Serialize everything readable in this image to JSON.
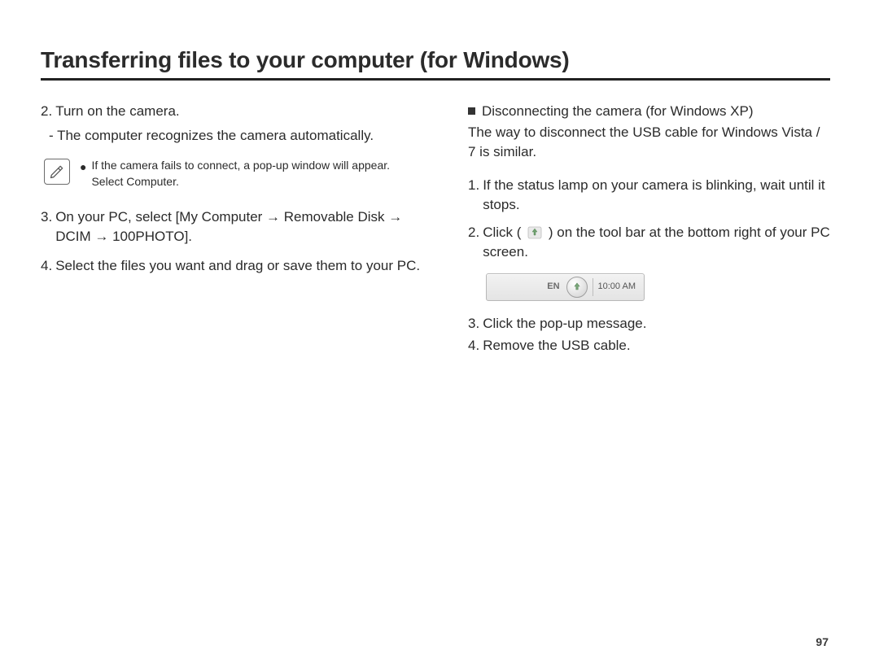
{
  "title": "Transferring files to your computer (for Windows)",
  "left": {
    "steps": [
      {
        "num": "2.",
        "text": "Turn on the camera."
      },
      {
        "num": "3.",
        "text": "On your PC, select [My Computer → Removable Disk → DCIM → 100PHOTO]."
      },
      {
        "num": "4.",
        "text": "Select the files you want and drag or save them to your PC."
      }
    ],
    "substep_after_2": "The computer recognizes the camera automatically.",
    "note": {
      "line1": "If the camera fails to connect, a pop-up window will appear.",
      "line2": "Select Computer."
    }
  },
  "right": {
    "heading": "Disconnecting the camera (for Windows XP)",
    "sub": "The way to disconnect the USB cable for Windows Vista / 7 is similar.",
    "steps": [
      {
        "num": "1.",
        "text": "If the status lamp on your camera is blinking, wait until it stops."
      },
      {
        "num": "2.",
        "before": "Click (",
        "after": ") on the tool bar at the bottom right of your PC screen."
      },
      {
        "num": "3.",
        "text": "Click the pop-up message."
      },
      {
        "num": "4.",
        "text": "Remove the USB cable."
      }
    ],
    "tray": {
      "lang": "EN",
      "time": "10:00 AM"
    }
  },
  "page_number": "97"
}
